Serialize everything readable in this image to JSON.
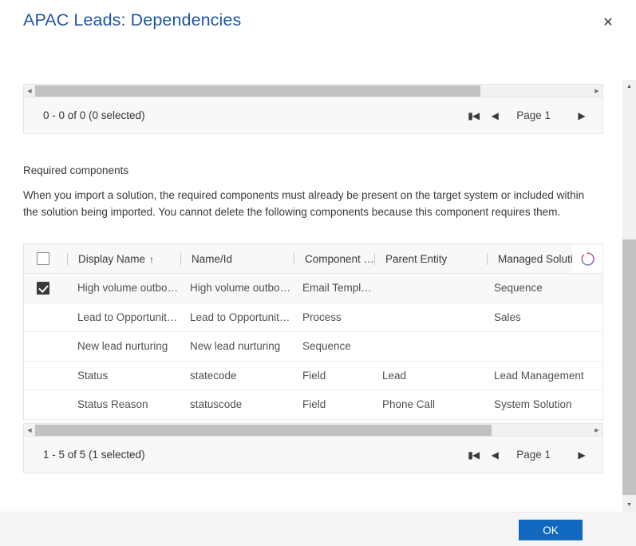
{
  "dialog": {
    "title": "APAC Leads: Dependencies",
    "close_icon": "close-icon",
    "ok_label": "OK"
  },
  "top_grid": {
    "scroll_left_icon": "scroll-left-icon",
    "scroll_right_icon": "scroll-right-icon",
    "pager": {
      "status": "0 - 0 of 0 (0 selected)",
      "first_icon": "first-page-icon",
      "prev_icon": "previous-page-icon",
      "page_label": "Page 1",
      "next_icon": "next-page-icon"
    }
  },
  "section": {
    "heading": "Required components",
    "body": "When you import a solution, the required components must already be present on the target system or included within the solution being imported. You cannot delete the following components because this component requires them."
  },
  "table": {
    "select_all_icon": "checkbox-unchecked-icon",
    "loading_icon": "loading-spinner-icon",
    "columns": [
      {
        "label": "Display Name",
        "sort": "↑"
      },
      {
        "label": "Name/Id",
        "sort": ""
      },
      {
        "label": "Component T...",
        "sort": ""
      },
      {
        "label": "Parent Entity",
        "sort": ""
      },
      {
        "label": "Managed Solution",
        "sort": ""
      }
    ],
    "rows": [
      {
        "selected": true,
        "display_name": "High volume outbou...",
        "name_id": "High volume outbou...",
        "component_type": "Email Template",
        "parent_entity": "",
        "managed_solution": "Sequence"
      },
      {
        "selected": false,
        "display_name": "Lead to Opportunity...",
        "name_id": "Lead to Opportunity...",
        "component_type": "Process",
        "parent_entity": "",
        "managed_solution": "Sales"
      },
      {
        "selected": false,
        "display_name": "New lead nurturing",
        "name_id": "New lead nurturing",
        "component_type": "Sequence",
        "parent_entity": "",
        "managed_solution": ""
      },
      {
        "selected": false,
        "display_name": "Status",
        "name_id": "statecode",
        "component_type": "Field",
        "parent_entity": "Lead",
        "managed_solution": "Lead Management"
      },
      {
        "selected": false,
        "display_name": "Status Reason",
        "name_id": "statuscode",
        "component_type": "Field",
        "parent_entity": "Phone Call",
        "managed_solution": "System Solution"
      }
    ]
  },
  "bottom_grid": {
    "scroll_left_icon": "scroll-left-icon",
    "scroll_right_icon": "scroll-right-icon",
    "pager": {
      "status": "1 - 5 of 5 (1 selected)",
      "first_icon": "first-page-icon",
      "prev_icon": "previous-page-icon",
      "page_label": "Page 1",
      "next_icon": "next-page-icon"
    }
  },
  "scrollbar": {
    "up_icon": "scroll-up-icon",
    "down_icon": "scroll-down-icon"
  },
  "colors": {
    "title": "#1f56a5",
    "primary_button": "#1068bf",
    "checkbox_checked": "#3b3a39"
  }
}
